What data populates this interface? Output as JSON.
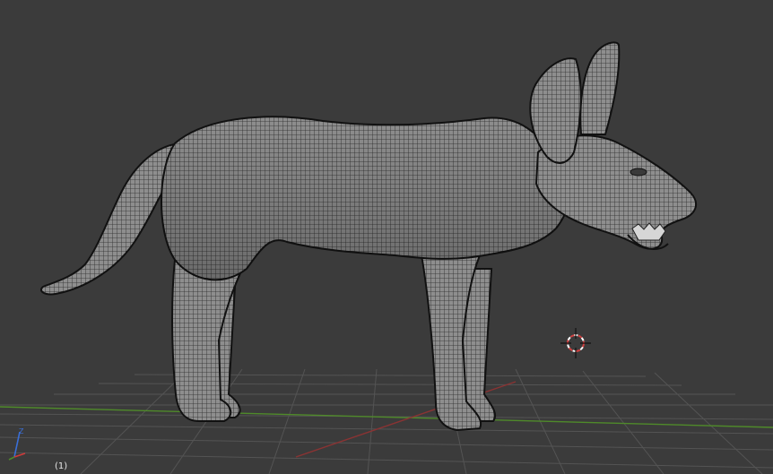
{
  "viewport": {
    "background": "#3b3b3b",
    "grid_color": "#545454",
    "x_axis_color": "#8a3333",
    "y_axis_color": "#4f8a2a",
    "frame_label": "(1)"
  },
  "model": {
    "icon": "dog-wireframe-mesh",
    "fill_color": "#8c8c8c",
    "wire_color": "#1e1e1e"
  },
  "cursor": {
    "icon": "3d-cursor-icon",
    "ring_color": "#d04040"
  },
  "gizmo": {
    "icon": "axis-gizmo-icon",
    "z_label": "Z",
    "z_color": "#3a6fd8",
    "x_color": "#d03a3a"
  }
}
